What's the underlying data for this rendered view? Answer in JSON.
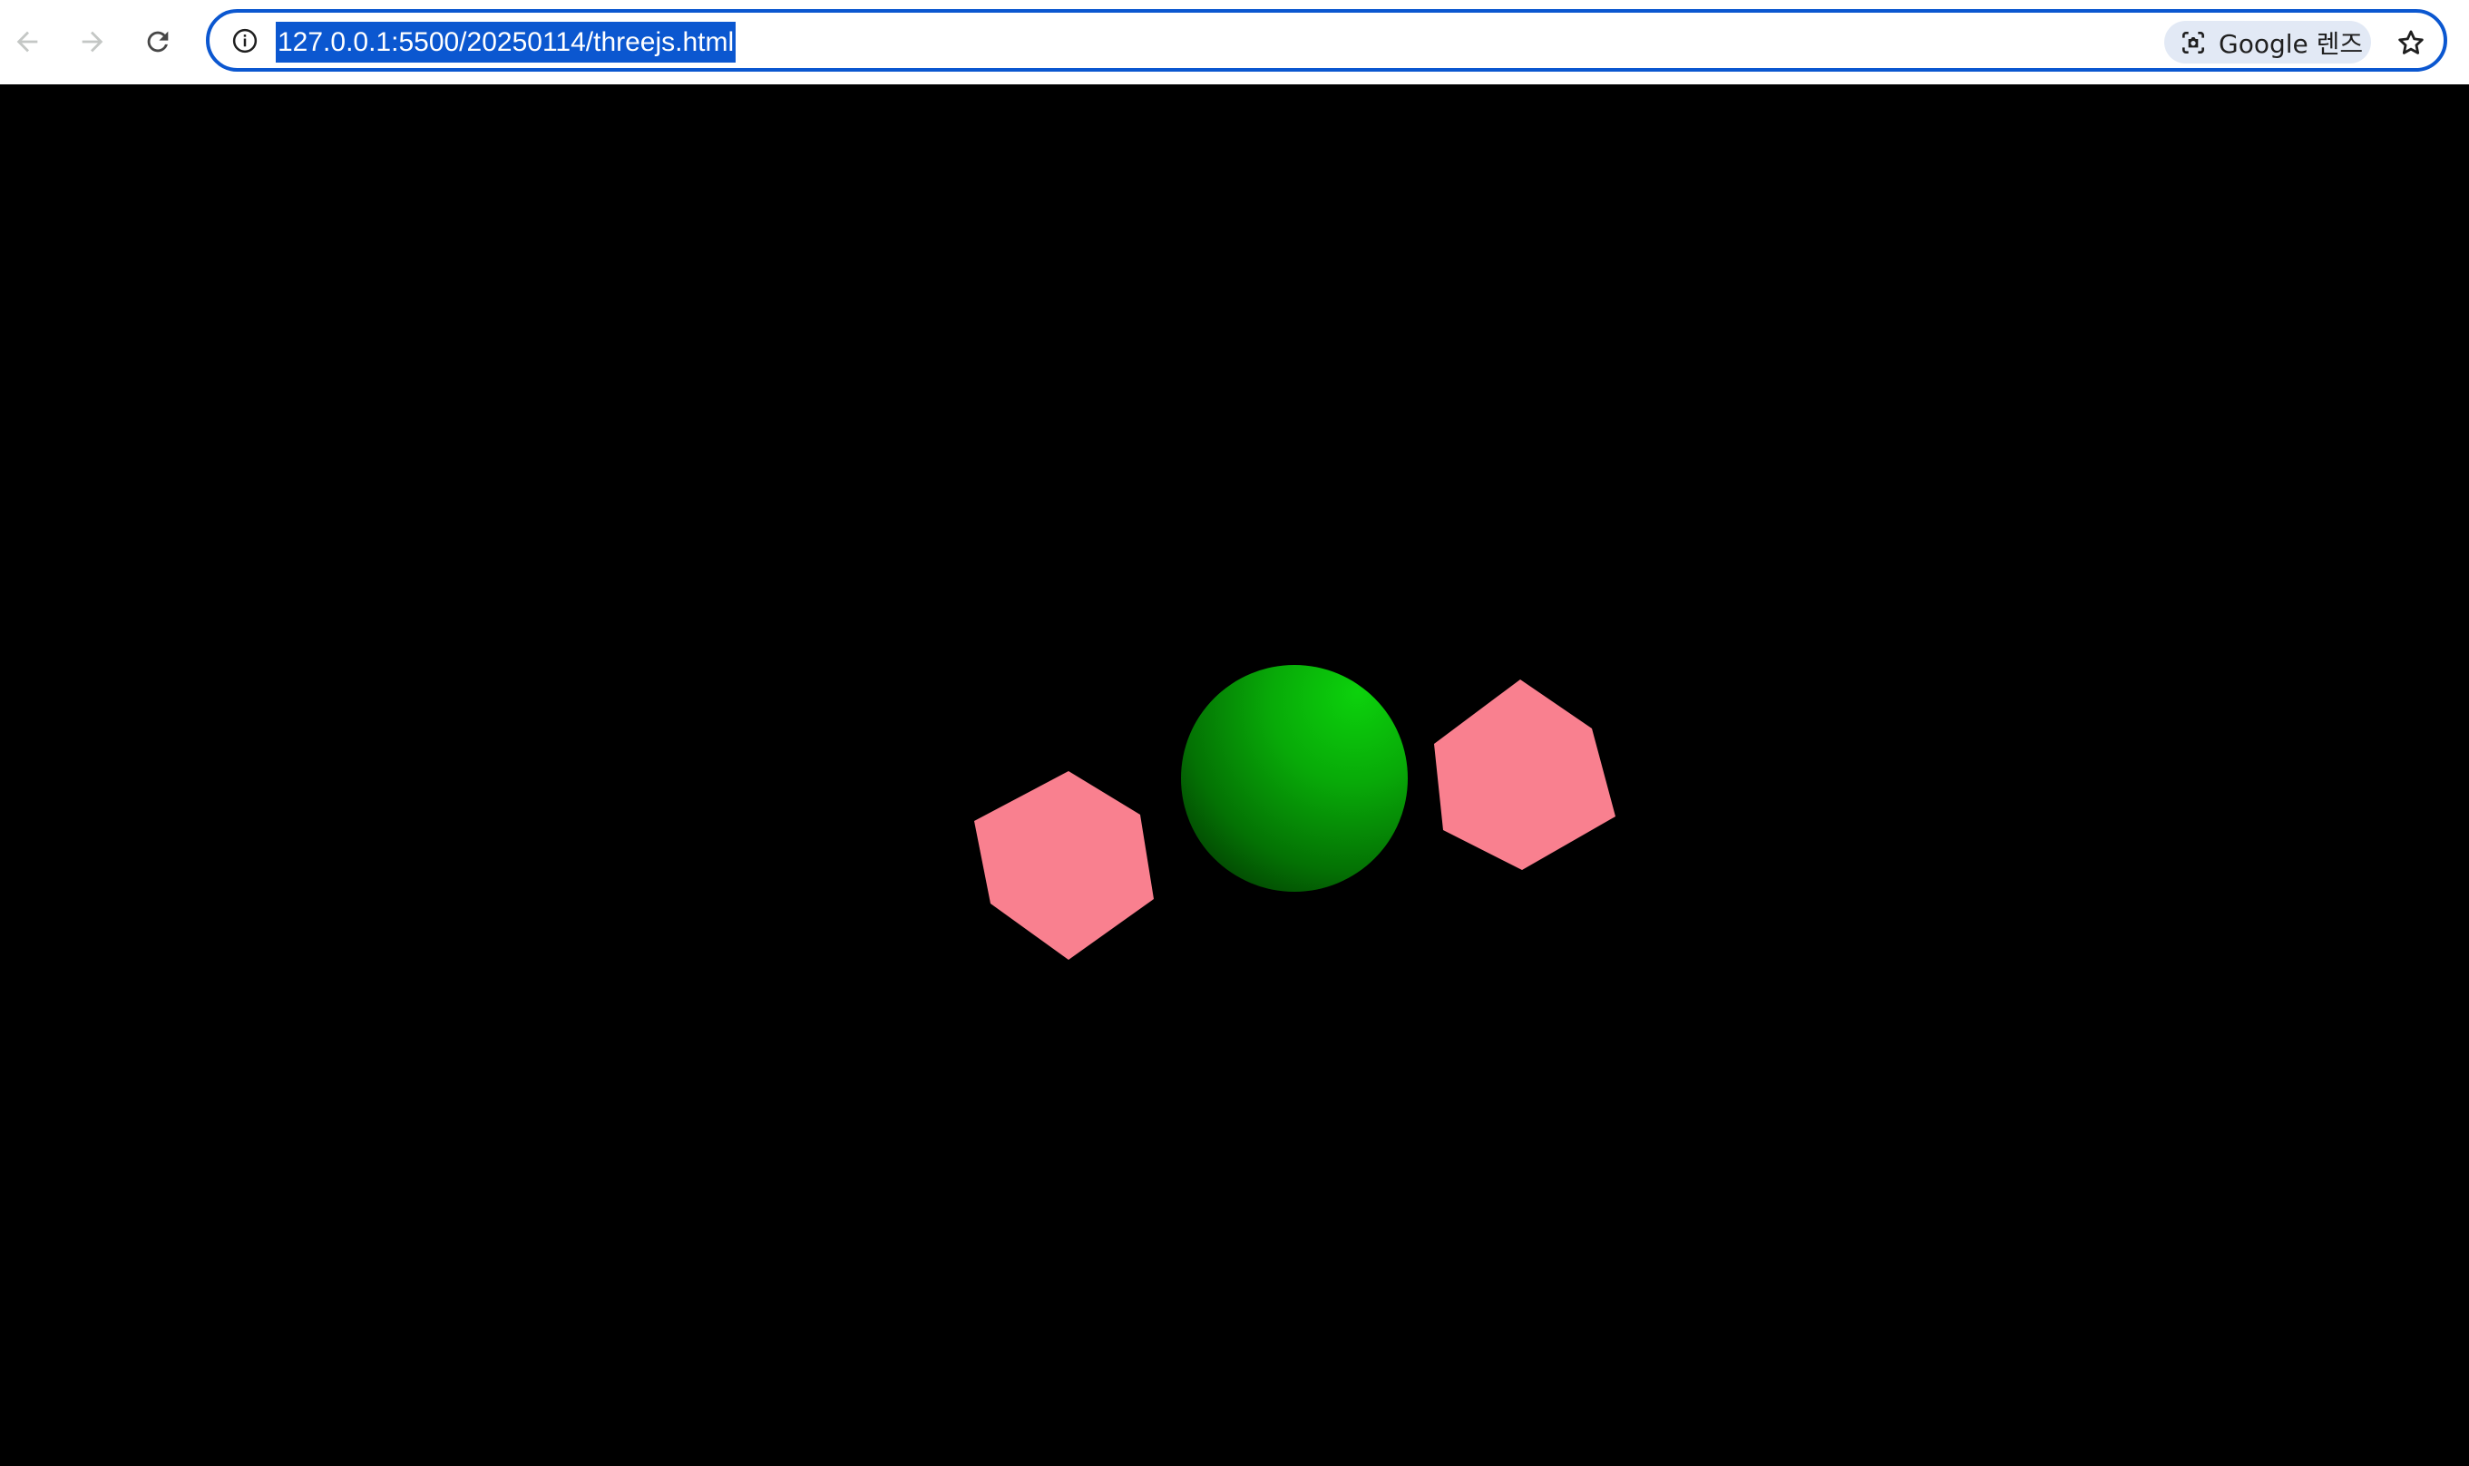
{
  "browser": {
    "back_icon": "arrow-left-icon",
    "forward_icon": "arrow-right-icon",
    "reload_icon": "reload-icon",
    "site_info_icon": "info-circle-icon",
    "url": "127.0.0.1:5500/20250114/threejs.html",
    "url_selected": true,
    "lens_icon": "google-lens-icon",
    "lens_label": "Google 렌즈",
    "bookmark_icon": "star-outline-icon",
    "accent_color": "#0b57d0"
  },
  "scene": {
    "background_color": "#000000",
    "objects": [
      {
        "name": "left-hexagon",
        "shape": "hexagon",
        "color": "#f9808f"
      },
      {
        "name": "center-sphere",
        "shape": "sphere",
        "color": "#0cc90c"
      },
      {
        "name": "right-hexagon",
        "shape": "hexagon",
        "color": "#f9808f"
      }
    ]
  }
}
